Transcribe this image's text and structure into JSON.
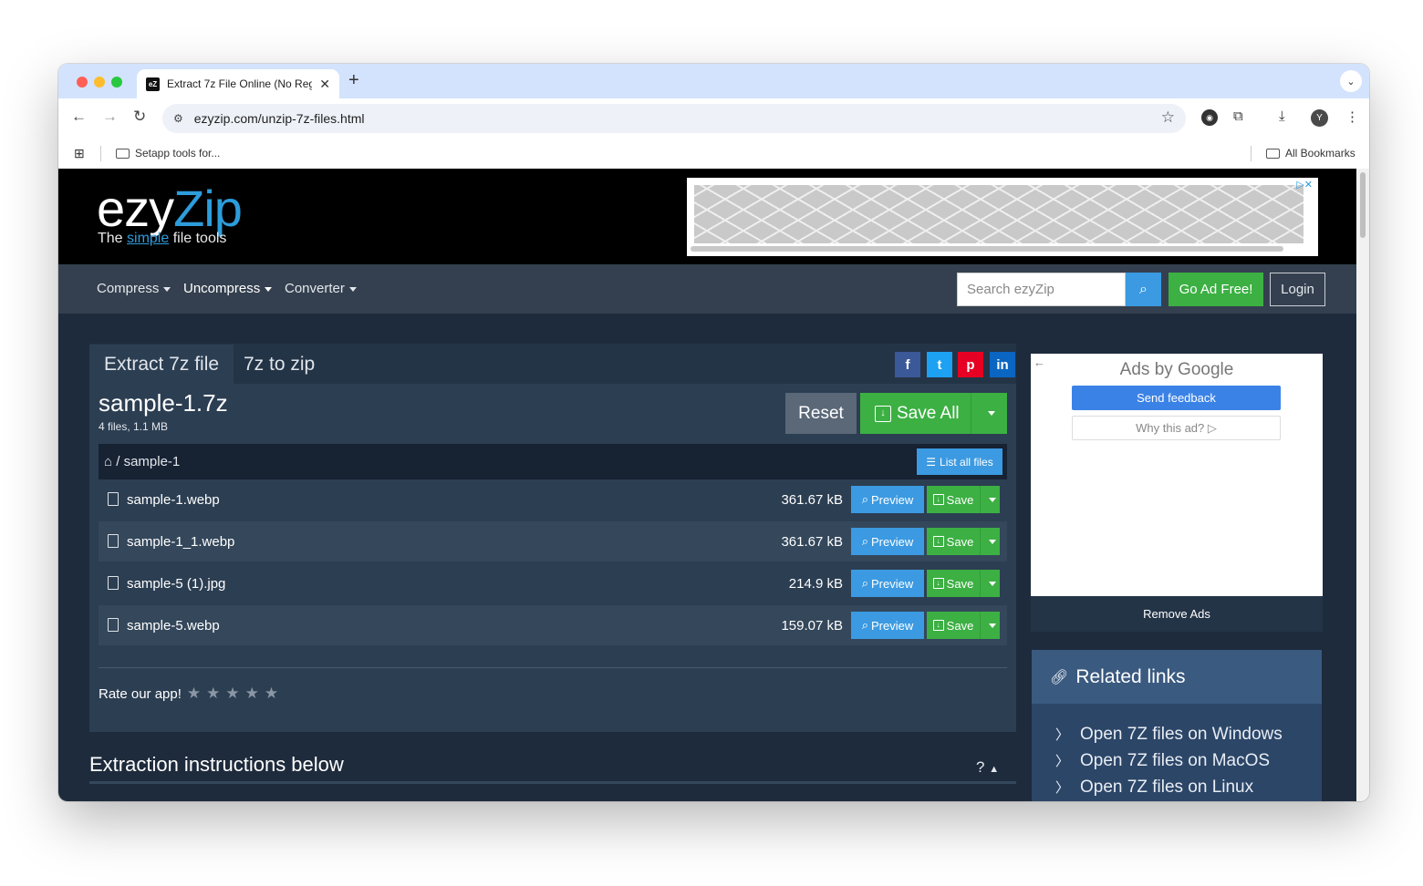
{
  "browser": {
    "tab_title": "Extract 7z File Online (No Reg",
    "favicon_text": "eZ",
    "url": "ezyzip.com/unzip-7z-files.html",
    "bookmark": "Setapp tools for...",
    "all_bookmarks": "All Bookmarks",
    "profile_initial": "Y"
  },
  "site": {
    "logo_part1": "ezy",
    "logo_part2": "Zip",
    "tagline_pre": "The ",
    "tagline_simple": "simple",
    "tagline_post": " file tools",
    "nav": [
      {
        "label": "Compress",
        "active": false
      },
      {
        "label": "Uncompress",
        "active": true
      },
      {
        "label": "Converter",
        "active": false
      }
    ],
    "search_placeholder": "Search ezyZip",
    "go_ad_free": "Go Ad Free!",
    "login": "Login"
  },
  "main": {
    "tabs": [
      "Extract 7z file",
      "7z to zip"
    ],
    "archive_name": "sample-1.7z",
    "archive_meta": "4 files, 1.1 MB",
    "reset_label": "Reset",
    "save_all_label": "Save All",
    "path": "/ sample-1",
    "list_all_label": "List all files",
    "preview_label": "Preview",
    "save_label": "Save",
    "files": [
      {
        "name": "sample-1.webp",
        "size": "361.67 kB"
      },
      {
        "name": "sample-1_1.webp",
        "size": "361.67 kB"
      },
      {
        "name": "sample-5 (1).jpg",
        "size": "214.9 kB"
      },
      {
        "name": "sample-5.webp",
        "size": "159.07 kB"
      }
    ],
    "rate_label": "Rate our app!",
    "rating": 0,
    "instructions_title": "Extraction instructions below",
    "help_label": "?"
  },
  "sidebar": {
    "ads_by": "Ads by Google",
    "send_feedback": "Send feedback",
    "why_ad": "Why this ad? ▷",
    "remove_ads": "Remove Ads",
    "related_title": "Related links",
    "related_links": [
      "Open 7Z files on Windows",
      "Open 7Z files on MacOS",
      "Open 7Z files on Linux"
    ]
  },
  "colors": {
    "brand_blue": "#2d9cdb",
    "green": "#3cb043",
    "button_blue": "#3b9ae1",
    "page_bg": "#1e2b3c"
  }
}
